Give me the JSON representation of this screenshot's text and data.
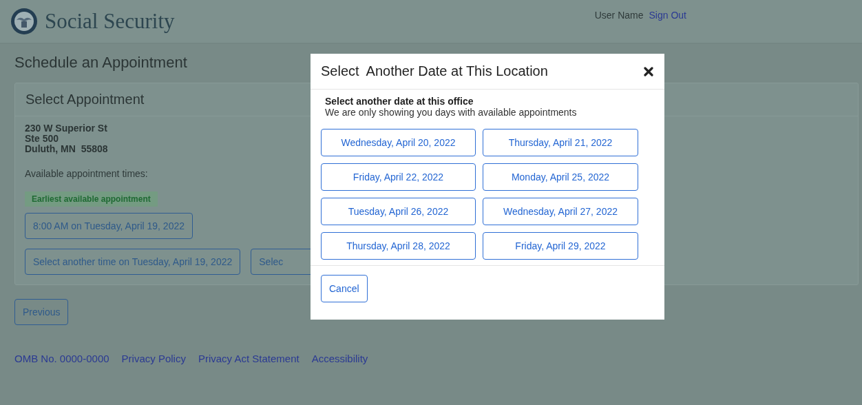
{
  "header": {
    "title": "Social Security",
    "user_name": "User Name",
    "sign_out": "Sign Out"
  },
  "page_title": "Schedule an Appointment",
  "panel": {
    "title": "Select Appointment",
    "address": [
      "230 W Superior St",
      "Ste 500",
      "Duluth, MN  55808"
    ],
    "times_label": "Available appointment times:",
    "earliest_badge": "Earliest available appointment",
    "earliest_button": "8:00 AM on Tuesday, April 19, 2022",
    "other_buttons": [
      "Select another time on Tuesday, April 19, 2022",
      "Selec"
    ]
  },
  "previous_button": "Previous",
  "footer": {
    "omb": "OMB No. 0000-0000",
    "links": [
      "Privacy Policy",
      "Privacy Act Statement",
      "Accessibility"
    ]
  },
  "modal": {
    "title": "Select  Another Date at This Location",
    "heading": "Select another date at this office",
    "note": "We are only showing you days with available appointments",
    "dates": [
      "Wednesday, April 20, 2022",
      "Thursday, April 21, 2022",
      "Friday, April 22, 2022",
      "Monday, April 25, 2022",
      "Tuesday, April 26, 2022",
      "Wednesday, April 27, 2022",
      "Thursday, April 28, 2022",
      "Friday, April 29, 2022"
    ],
    "cancel": "Cancel"
  }
}
